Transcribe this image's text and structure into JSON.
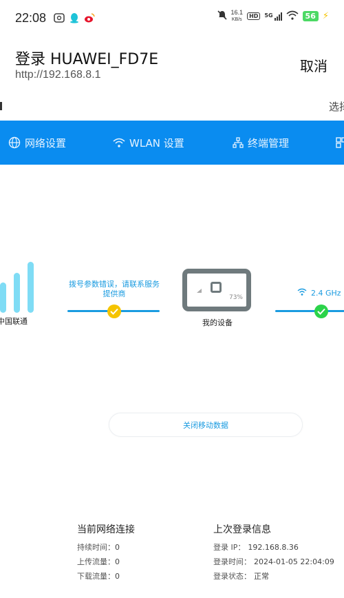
{
  "status_bar": {
    "time": "22:08",
    "net_speed_value": "16.1",
    "net_speed_unit": "KB/s",
    "hd_badge": "HD",
    "signal_label": "5G",
    "battery": "56",
    "icons": [
      "wallet-icon",
      "qq-icon",
      "weibo-icon",
      "mute-icon",
      "wifi-icon",
      "charging-icon"
    ],
    "battery_color": "#4cd964"
  },
  "header": {
    "title": "登录 HUAWEI_FD7E",
    "url": "http://192.168.8.1",
    "cancel_label": "取消"
  },
  "strip": {
    "right_text": "选择"
  },
  "nav": {
    "bg_color": "#0a8cf0",
    "items": [
      {
        "label": "网络设置",
        "icon": "globe-icon"
      },
      {
        "label": "WLAN 设置",
        "icon": "wifi-icon"
      },
      {
        "label": "终端管理",
        "icon": "topology-icon"
      },
      {
        "label": "",
        "icon": "grid-icon"
      }
    ]
  },
  "topology": {
    "isp_label": "中国联通",
    "error_text": "拨号参数错误，请联系服务提供商",
    "device_percent": "73%",
    "device_label": "我的设备",
    "band_label": "2.4 GHz",
    "accent_color": "#1a9be0",
    "warning_color": "#f5c400",
    "ok_color": "#2bd34a"
  },
  "close_data_button": "关闭移动数据",
  "current_connection": {
    "title": "当前网络连接",
    "rows": [
      {
        "key": "持续时间：",
        "value": "0"
      },
      {
        "key": "上传流量：",
        "value": "0"
      },
      {
        "key": "下载流量：",
        "value": "0"
      }
    ]
  },
  "last_login": {
    "title": "上次登录信息",
    "rows": [
      {
        "key": "登录 IP：",
        "value": "192.168.8.36"
      },
      {
        "key": "登录时间：",
        "value": "2024-01-05 22:04:09"
      },
      {
        "key": "登录状态：",
        "value": "正常"
      }
    ]
  }
}
